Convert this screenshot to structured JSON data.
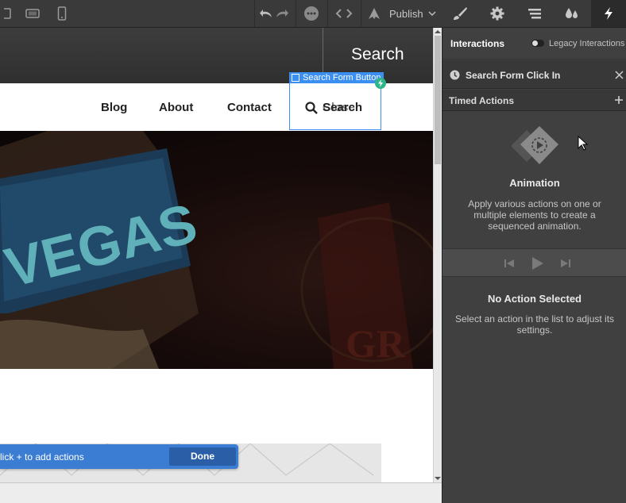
{
  "toolbar": {
    "publish_label": "Publish",
    "icons": [
      "tablet-landscape-icon",
      "tablet-portrait-icon",
      "mobile-icon",
      "undo-icon",
      "redo-icon",
      "more-icon",
      "code-icon",
      "publish-icon",
      "chevron-down-icon"
    ]
  },
  "panel_tabs": [
    "style-brush-icon",
    "settings-gear-icon",
    "navigator-icon",
    "style-manager-icon",
    "interactions-bolt-icon"
  ],
  "canvas": {
    "search_heading": "Search",
    "nav_links": [
      "Blog",
      "About",
      "Contact"
    ],
    "search_button_text": "Search",
    "search_button_overlap_text": "Close",
    "selection_label": "Search Form Button",
    "accent": "#3b8ff0"
  },
  "action_bar": {
    "hint": "lick + to add actions",
    "done_label": "Done"
  },
  "panel": {
    "title": "Interactions",
    "legacy_label": "Legacy Interactions",
    "trigger_label": "Search Form Click In",
    "timed_actions_label": "Timed Actions",
    "animation_title": "Animation",
    "animation_desc": "Apply various actions on one or multiple elements to create a sequenced animation.",
    "no_action_title": "No Action Selected",
    "no_action_desc": "Select an action in the list to adjust its settings."
  }
}
